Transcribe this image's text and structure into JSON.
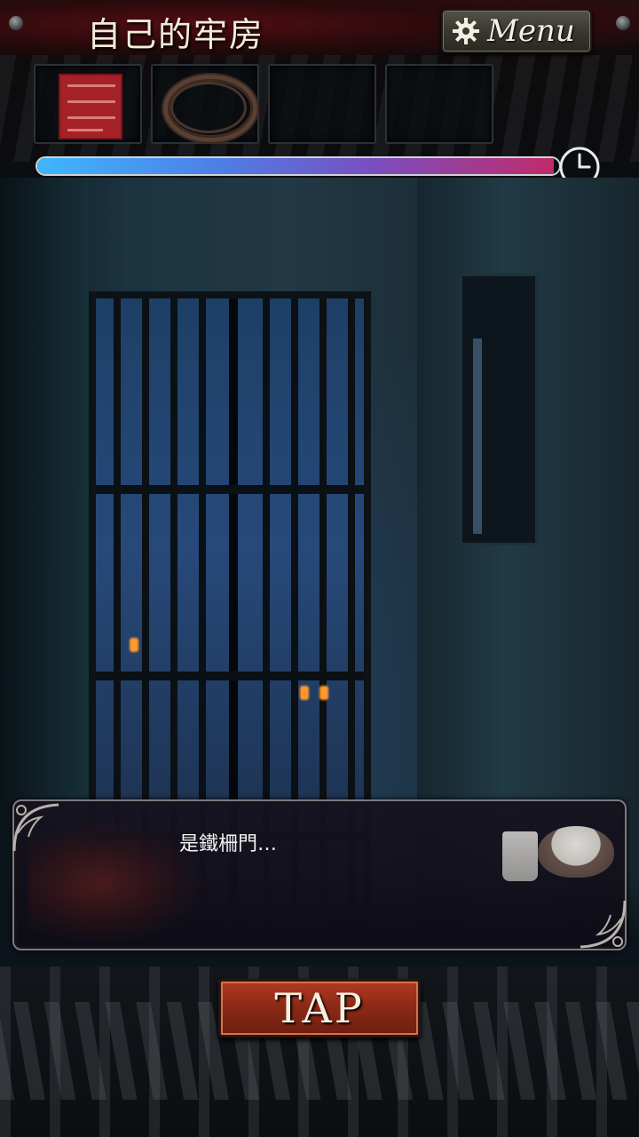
{
  "header": {
    "room_title": "自己的牢房",
    "menu_label": "Menu"
  },
  "inventory": {
    "slots": [
      {
        "item": "menu-card"
      },
      {
        "item": "rope"
      },
      {
        "item": ""
      },
      {
        "item": ""
      }
    ]
  },
  "timer": {
    "remaining_fraction": 0.99
  },
  "dialog": {
    "text": "是鐵柵門…"
  },
  "actions": {
    "tap_label": "TAP"
  },
  "colors": {
    "timer_start": "#3fb7ff",
    "timer_end": "#c02b6a",
    "tap_button": "#8c2a16"
  }
}
